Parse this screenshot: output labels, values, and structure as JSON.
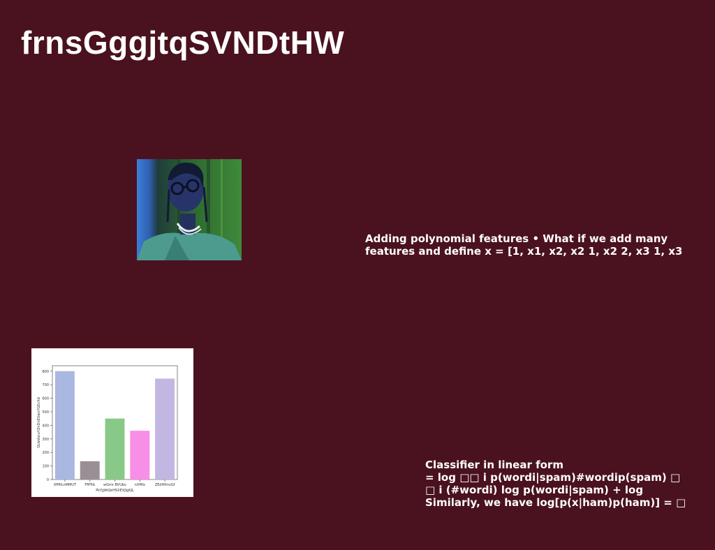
{
  "slide": {
    "title": "frnsGggjtqSVNDtHW",
    "photo_icon": "portrait-photo",
    "text_block_1": {
      "lines": [
        "Adding polynomial features • What if we add many",
        "features and define x = [1, x1, x2, x2 1, x2 2, x3 1, x3"
      ]
    },
    "text_block_2": {
      "lines": [
        "Classifier in linear form",
        "= log □□ i p(wordi|spam)#wordip(spam) □",
        "□ i (#wordi) log p(wordi|spam) + log",
        "Similarly, we have log[p(x|ham)p(ham)] = □"
      ]
    }
  },
  "chart_data": {
    "type": "bar",
    "categories": [
      "XfMILnMMUT",
      "FMTrb",
      "wGmr BVUbv",
      "nXMIx",
      "ZEdHfmvGf"
    ],
    "values": [
      800,
      135,
      450,
      360,
      745
    ],
    "colors": [
      "#a9b8e0",
      "#9a8f94",
      "#88c987",
      "#f78fe6",
      "#c2b6e2"
    ],
    "xlabel": "PkYjJAtQeHSXEXJlgKJL",
    "ylabel": "GUaVocuYZnDnEUwxYGEcXd",
    "yticks": [
      0,
      100,
      200,
      300,
      400,
      500,
      600,
      700,
      800
    ],
    "ylim": [
      0,
      840
    ]
  }
}
